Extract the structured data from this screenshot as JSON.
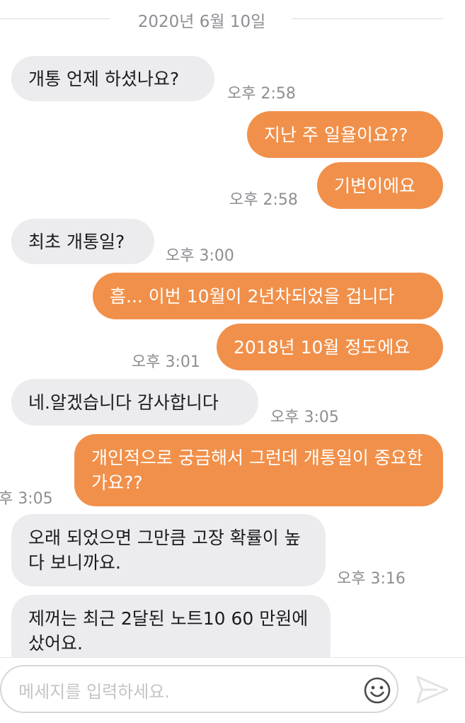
{
  "date_separator": "2020년 6월 10일",
  "messages": [
    {
      "text": "개통 언제 하셨나요?"
    },
    {
      "text": "지난 주 일욜이요??"
    },
    {
      "text": "기변이에요"
    },
    {
      "text": "최초 개통일?"
    },
    {
      "text": "흠... 이번 10월이 2년차되었을 겁니다"
    },
    {
      "text": "2018년 10월 정도에요"
    },
    {
      "text": "네.알겠습니다 감사합니다"
    },
    {
      "text": "개인적으로 궁금해서 그런데 개통일이 중요한가요??"
    },
    {
      "text": "오래 되었으면 그만큼 고장 확률이 높다 보니까요."
    },
    {
      "text": "제꺼는 최근 2달된 노트10  60  만원에 샀어요."
    }
  ],
  "timestamps": [
    "오후 2:58",
    "오후 2:58",
    "오후 3:00",
    "오후 3:01",
    "오후 3:05",
    "후 3:05",
    "오후 3:16"
  ],
  "composer": {
    "placeholder": "메세지를 입력하세요."
  },
  "icons": {
    "emoji": "smiley-face-icon",
    "send": "paper-plane-icon"
  },
  "colors": {
    "outgoing_bubble": "#f1904a",
    "incoming_bubble": "#ececef",
    "timestamp": "#8e8e93"
  }
}
